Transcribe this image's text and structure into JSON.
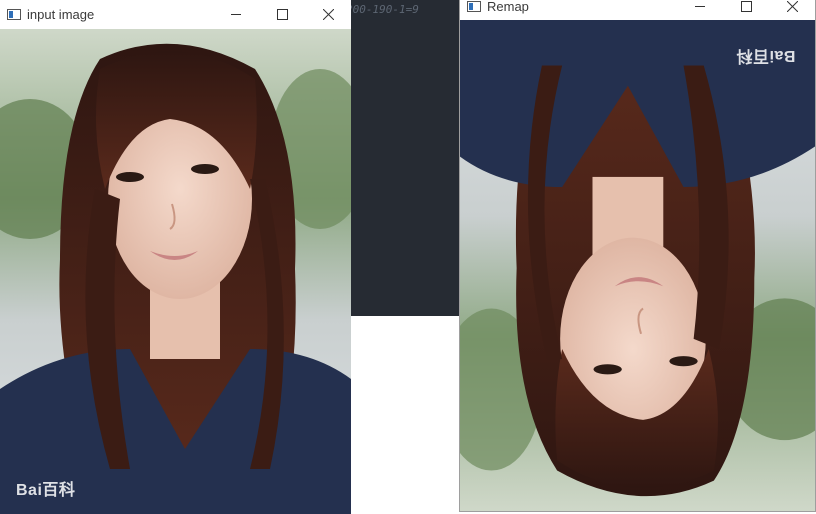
{
  "background_ide": {
    "code_fragment": "200-190-1=9"
  },
  "windows": [
    {
      "title": "input image",
      "controls": [
        "minimize-icon",
        "maximize-icon",
        "close-icon"
      ],
      "watermark": "Bai百科"
    },
    {
      "title": "Remap",
      "controls": [
        "minimize-icon",
        "maximize-icon",
        "close-icon"
      ],
      "watermark": "Bai百科"
    }
  ],
  "colors": {
    "ide_background": "#262b33",
    "shirt": "#24304f",
    "hair": "#3a1c14"
  }
}
